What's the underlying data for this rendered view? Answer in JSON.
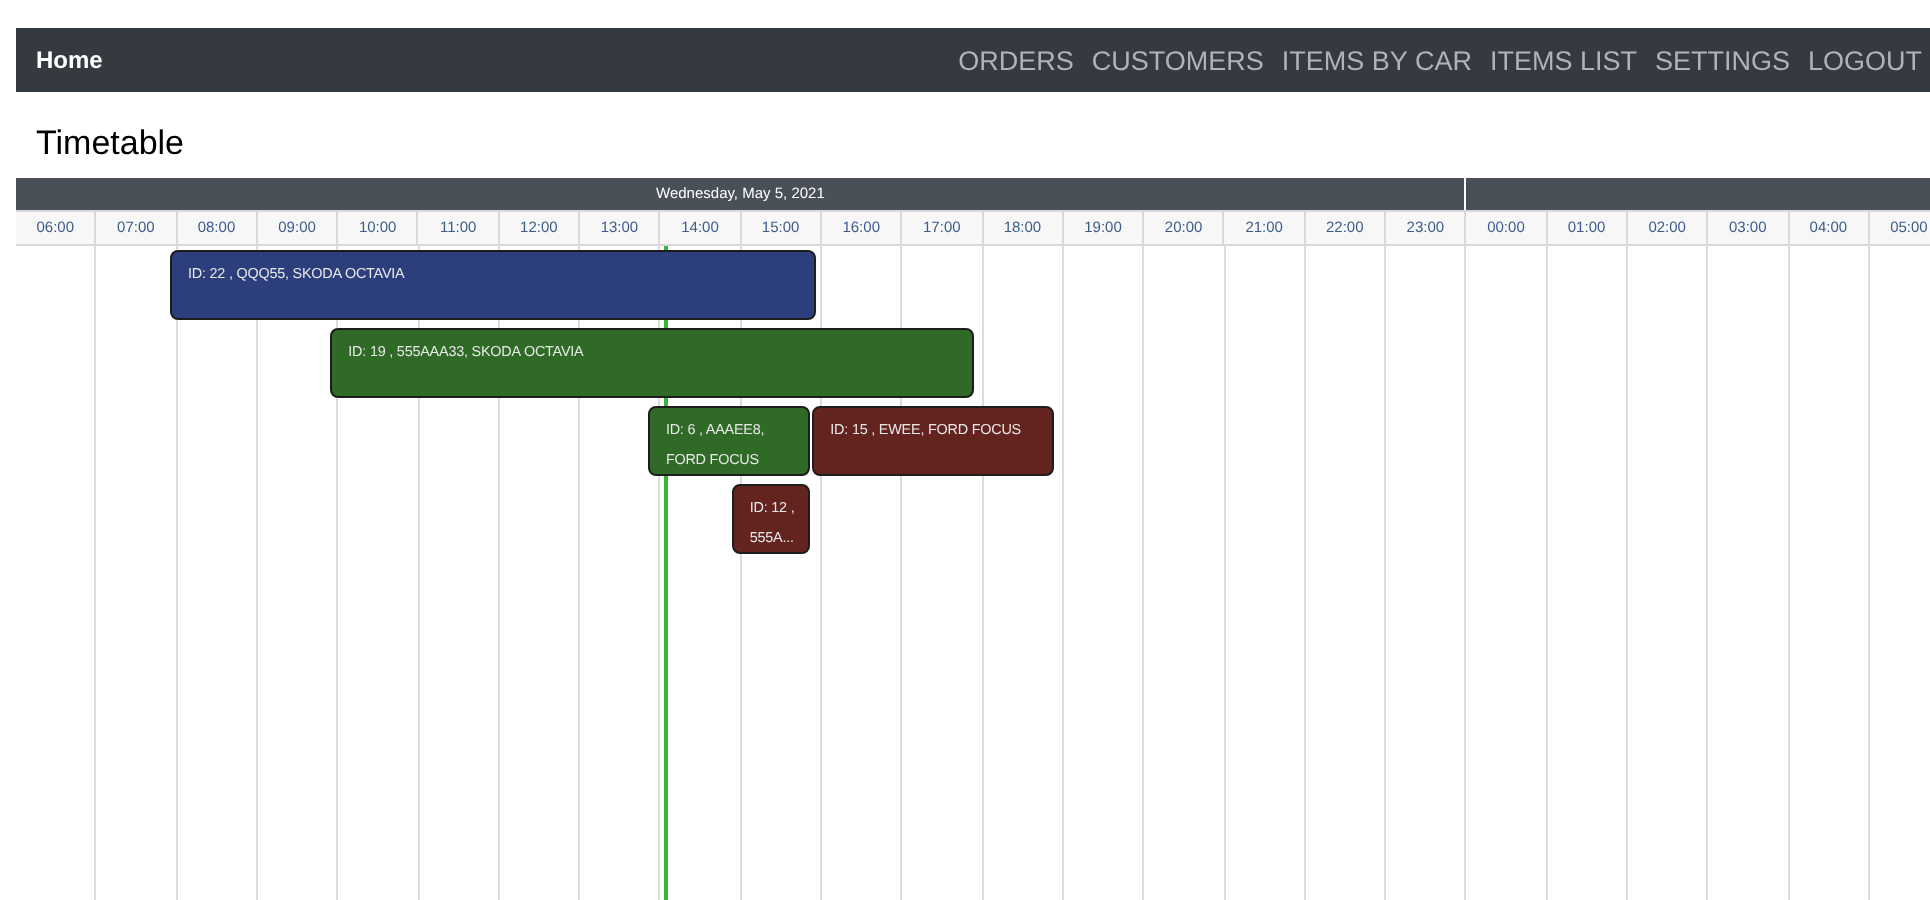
{
  "nav": {
    "brand": "Home",
    "links": [
      "ORDERS",
      "CUSTOMERS",
      "ITEMS BY CAR",
      "ITEMS LIST",
      "SETTINGS",
      "LOGOUT"
    ]
  },
  "title": "Timetable",
  "timeline": {
    "days": [
      {
        "label": "Wednesday, May 5, 2021",
        "hours": [
          "06:00",
          "07:00",
          "08:00",
          "09:00",
          "10:00",
          "11:00",
          "12:00",
          "13:00",
          "14:00",
          "15:00",
          "16:00",
          "17:00",
          "18:00",
          "19:00",
          "20:00",
          "21:00",
          "22:00",
          "23:00"
        ]
      },
      {
        "hours": [
          "00:00",
          "01:00",
          "02:00",
          "03:00",
          "04:00",
          "05:00"
        ]
      }
    ],
    "events": [
      {
        "text": "ID: 22 , QQQ55, SKODA OCTAVIA",
        "color": "#2c3f7c"
      },
      {
        "text": "ID: 19 , 555AAA33, SKODA OCTAVIA",
        "color": "#2f6a26"
      },
      {
        "text": "ID: 6 , AAAEE8, FORD FOCUS",
        "color": "#2f6a26"
      },
      {
        "text": "ID: 15 , EWEE, FORD FOCUS",
        "color": "#63231f"
      },
      {
        "text": "ID: 12 , 555A...",
        "color": "#63231f"
      }
    ]
  }
}
